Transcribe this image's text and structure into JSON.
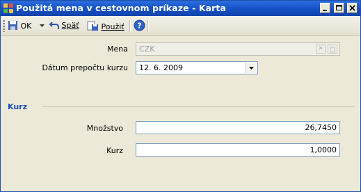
{
  "window": {
    "title": "Použitá mena v cestovnom príkaze - Karta",
    "controls": [
      "minimize-icon",
      "maximize-icon",
      "close-icon"
    ]
  },
  "toolbar": {
    "ok_label": "OK",
    "undo_label": "Späť",
    "apply_label": "Použiť"
  },
  "form": {
    "currency_label": "Mena",
    "currency_value": "CZK",
    "date_label": "Dátum prepočtu kurzu",
    "date_value": "12. 6. 2009",
    "group_title": "Kurz",
    "amount_label": "Množstvo",
    "amount_value": "26,7450",
    "rate_label": "Kurz",
    "rate_value": "1,0000"
  },
  "colors": {
    "titlebar": "#1550c4",
    "group_title": "#1a4fb5",
    "background": "#ece9d8"
  }
}
